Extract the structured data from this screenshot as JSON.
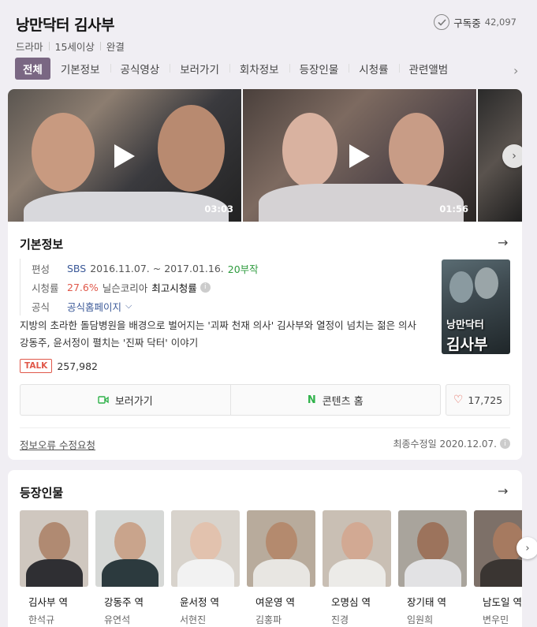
{
  "header": {
    "title": "낭만닥터 김사부",
    "subscribe_label": "구독중",
    "subscribe_count": "42,097",
    "meta": [
      "드라마",
      "15세이상",
      "완결"
    ]
  },
  "tabs": [
    {
      "label": "전체",
      "active": true
    },
    {
      "label": "기본정보"
    },
    {
      "label": "공식영상"
    },
    {
      "label": "보러가기"
    },
    {
      "label": "회차정보"
    },
    {
      "label": "등장인물"
    },
    {
      "label": "시청률"
    },
    {
      "label": "관련앨범"
    }
  ],
  "videos": [
    {
      "duration": "03:03"
    },
    {
      "duration": "01:56"
    }
  ],
  "basic": {
    "title": "기본정보",
    "broadcast_label": "편성",
    "broadcaster": "SBS",
    "period": "2016.11.07. ~ 2017.01.16.",
    "episodes": "20부작",
    "rating_label": "시청률",
    "rating": "27.6%",
    "rating_source": "닐슨코리아",
    "rating_note": "최고시청률",
    "official_label": "공식",
    "official_link": "공식홈페이지",
    "description": "지방의 초라한 돌담병원을 배경으로 벌어지는 '괴짜 천재 의사' 김사부와 열정이 넘치는 젊은 의사 강동주, 윤서정이 펼치는 '진짜 닥터' 이야기",
    "poster_text_small": "낭만닥터",
    "poster_text_big": "김사부",
    "talk_badge": "TALK",
    "talk_count": "257,982",
    "watch_button": "보러가기",
    "content_home_button": "콘텐츠 홈",
    "like_count": "17,725",
    "report_link": "정보오류 수정요청",
    "updated": "최종수정일 2020.12.07."
  },
  "cast": {
    "title": "등장인물",
    "members": [
      {
        "role": "김사부 역",
        "actor": "한석규"
      },
      {
        "role": "강동주 역",
        "actor": "유연석"
      },
      {
        "role": "윤서정 역",
        "actor": "서현진"
      },
      {
        "role": "여운영 역",
        "actor": "김홍파"
      },
      {
        "role": "오명심 역",
        "actor": "진경"
      },
      {
        "role": "장기태 역",
        "actor": "임원희"
      },
      {
        "role": "남도일 역",
        "actor": "변우민"
      }
    ]
  },
  "colors": {
    "accent": "#7a6783",
    "rating_red": "#e0584a",
    "episodes_green": "#2e9b3e",
    "link_blue": "#3b5998"
  }
}
